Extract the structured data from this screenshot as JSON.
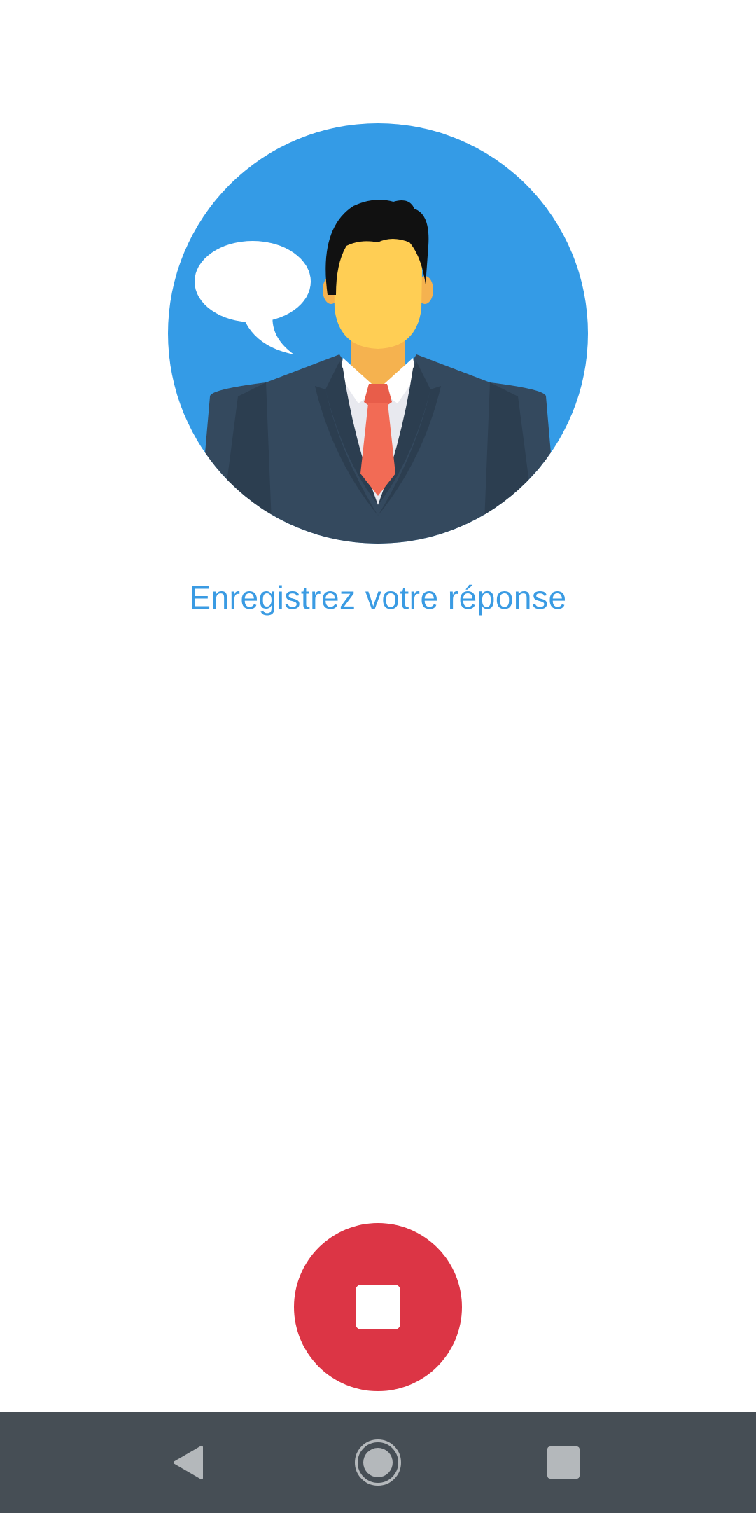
{
  "main": {
    "prompt_text": "Enregistrez votre réponse"
  },
  "icons": {
    "avatar": "businessman-with-speech-bubble-icon",
    "record_button": "stop-icon",
    "nav_back": "back-triangle-icon",
    "nav_home": "home-circle-icon",
    "nav_recents": "recents-square-icon"
  },
  "colors": {
    "accent": "#3a9be3",
    "avatar_background": "#349be6",
    "stop_button": "#dc3545",
    "navbar": "#464e55",
    "nav_icons": "#b4b8bb"
  }
}
